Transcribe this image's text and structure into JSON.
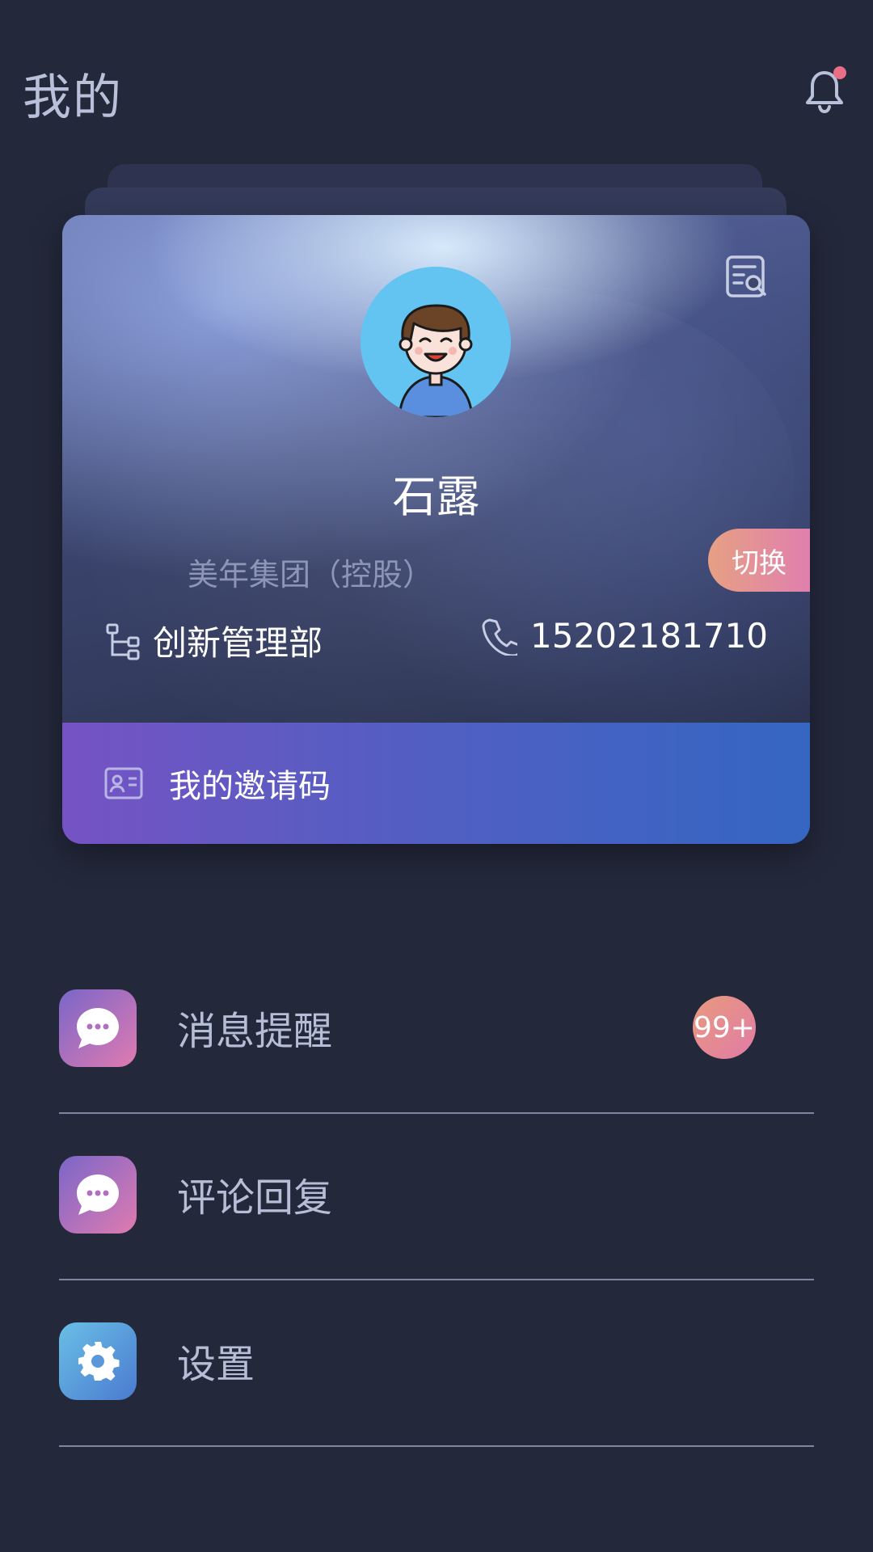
{
  "header": {
    "title": "我的"
  },
  "profile": {
    "name": "石露",
    "company": "美年集团（控股）",
    "switch_label": "切换",
    "department": "创新管理部",
    "phone": "15202181710",
    "invite_label": "我的邀请码"
  },
  "menu": {
    "items": [
      {
        "label": "消息提醒",
        "icon": "chat-bubble-icon",
        "badge": "99+"
      },
      {
        "label": "评论回复",
        "icon": "chat-bubble-icon"
      },
      {
        "label": "设置",
        "icon": "gear-icon"
      }
    ]
  },
  "colors": {
    "background": "#23283b",
    "accent_pink": "#e07ba6",
    "invite_gradient_start": "#7653c5",
    "invite_gradient_end": "#3566c2",
    "settings_icon_gradient_start": "#69bfe6",
    "settings_icon_gradient_end": "#4b7ad0"
  }
}
